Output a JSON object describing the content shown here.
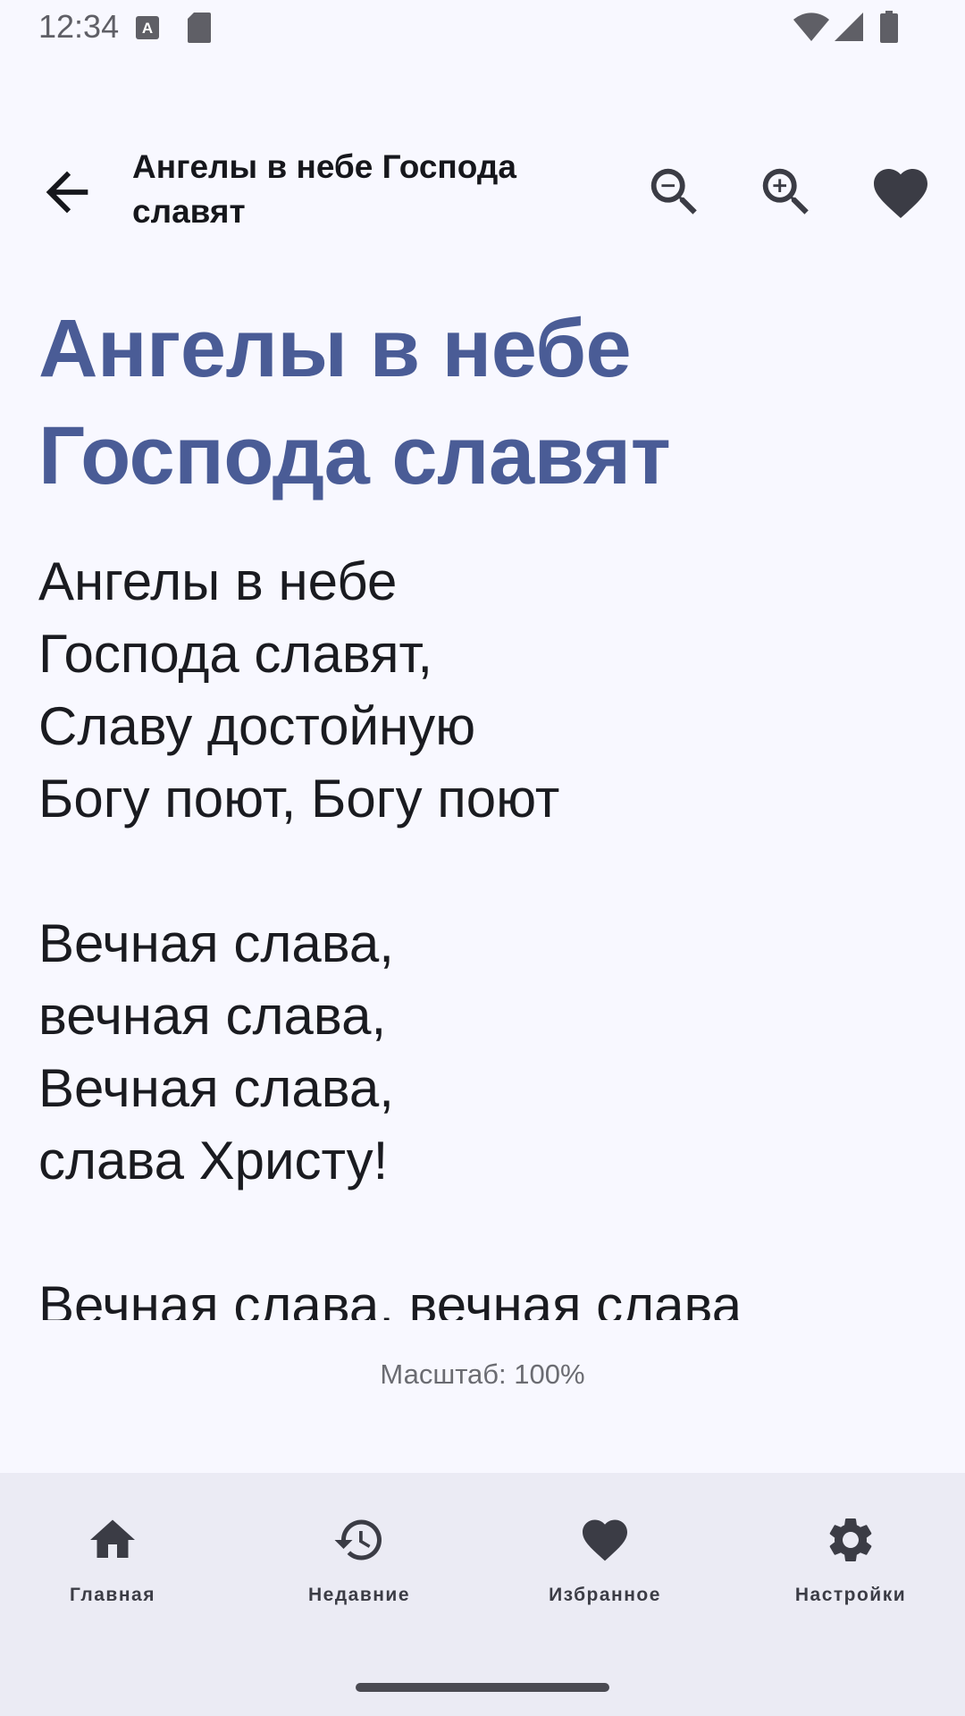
{
  "status_bar": {
    "time": "12:34",
    "icons": [
      "font-notification-icon",
      "sd-card-icon",
      "wifi-icon",
      "signal-icon",
      "battery-icon"
    ]
  },
  "app_bar": {
    "title": "Ангелы в небе Господа славят",
    "actions": [
      "zoom-out-icon",
      "zoom-in-icon",
      "favorite-icon"
    ]
  },
  "song": {
    "title": "Ангелы в небе Господа славят",
    "lyrics": "Ангелы в небе\nГоспода славят,\nСлаву достойную\nБогу поют, Богу поют\n\nВечная слава,\nвечная слава,\nВечная слава,\nслава Христу!\n\nВечная слава, вечная слава"
  },
  "scale": {
    "label": "Масштаб: 100%"
  },
  "bottom_nav": {
    "items": [
      {
        "label": "Главная",
        "icon": "home-icon"
      },
      {
        "label": "Недавние",
        "icon": "history-icon"
      },
      {
        "label": "Избранное",
        "icon": "favorite-icon"
      },
      {
        "label": "Настройки",
        "icon": "settings-icon"
      }
    ]
  },
  "colors": {
    "background": "#f8f8ff",
    "title_accent": "#4a5c96",
    "nav_background": "#ebebf4"
  }
}
